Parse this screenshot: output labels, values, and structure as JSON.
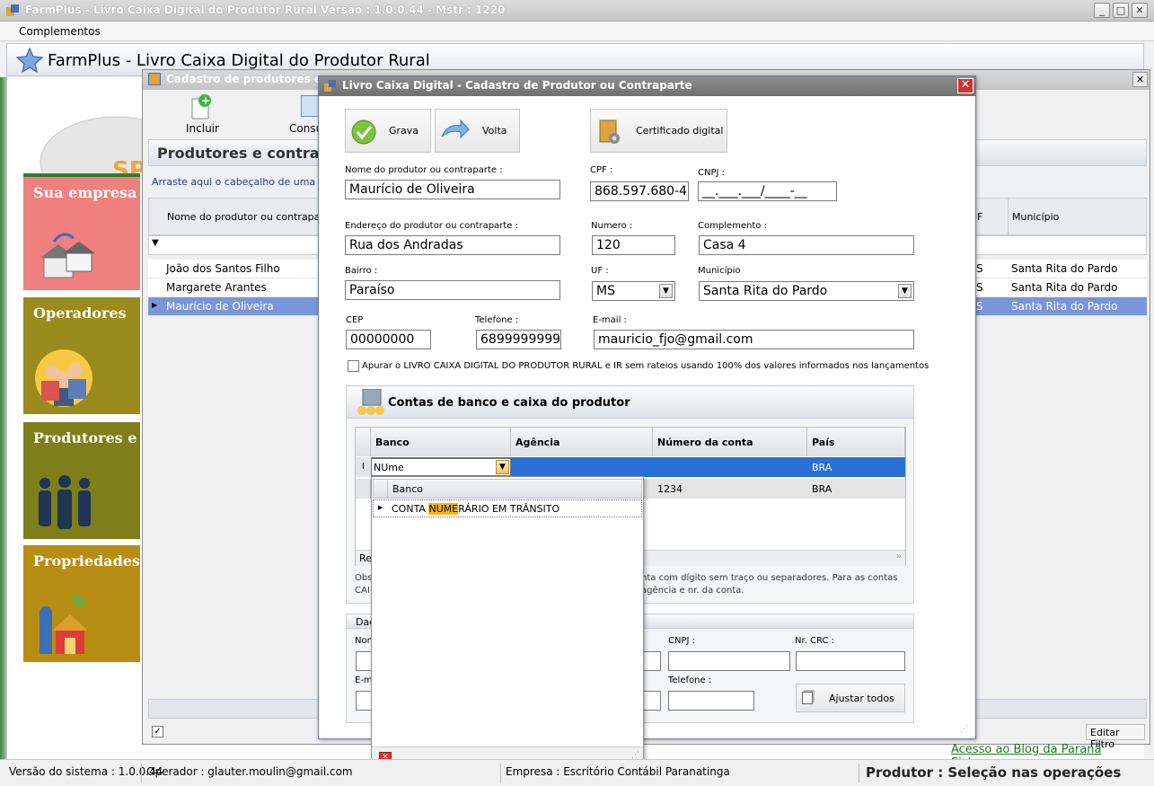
{
  "app": {
    "window_title": "FarmPlus - Livro Caixa Digital do Produtor Rural Versão : 1.0.0.44 - Mstr : 1220",
    "menu": [
      "Complementos"
    ],
    "header_title": "FarmPlus - Livro Caixa Digital do Produtor Rural"
  },
  "sidebar": {
    "items": [
      {
        "label": "Sua empresa",
        "color": "#f08080"
      },
      {
        "label": "Operadores",
        "color": "#9b8a1c"
      },
      {
        "label": "Produtores e c",
        "color": "#7e7e1a"
      },
      {
        "label": "Propriedades",
        "color": "#b88d14"
      }
    ]
  },
  "back_window": {
    "title": "Cadastro de produtores e c",
    "toolbar": {
      "incluir": "Incluir",
      "consultar": "Consu"
    },
    "section_title": "Produtores e contrapa",
    "group_hint": "Arraste aqui o cabeçalho de uma colun",
    "columns": {
      "nome": "Nome do produtor ou contraparte",
      "uf": "F",
      "municipio": "Município"
    },
    "rows": [
      {
        "nome": "João dos Santos Filho",
        "uf": "S",
        "municipio": "Santa Rita do Pardo"
      },
      {
        "nome": "Margarete Arantes",
        "uf": "S",
        "municipio": "Santa Rita do Pardo"
      },
      {
        "nome": "Maurício de Oliveira",
        "uf": "S",
        "municipio": "Santa Rita do Pardo"
      }
    ],
    "edit_filter": "Editar Filtro"
  },
  "dialog": {
    "title": "Livro Caixa Digital - Cadastro de Produtor ou Contraparte",
    "buttons": {
      "grava": "Grava",
      "volta": "Volta",
      "certificado": "Certificado digital"
    },
    "labels": {
      "nome": "Nome do produtor ou contraparte :",
      "cpf": "CPF :",
      "cnpj": "CNPJ :",
      "endereco": "Endereço do produtor ou contraparte :",
      "numero": "Numero :",
      "complemento": "Complemento :",
      "bairro": "Bairro :",
      "uf": "UF :",
      "municipio": "Município",
      "cep": "CEP",
      "telefone": "Telefone :",
      "email": "E-mail :"
    },
    "values": {
      "nome": "Maurício de Oliveira",
      "cpf": "868.597.680-45",
      "cnpj": "__.___.___/____-__",
      "endereco": "Rua dos Andradas",
      "numero": "120",
      "complemento": "Casa 4",
      "bairro": "Paraíso",
      "uf": "MS",
      "municipio": "Santa Rita do Pardo",
      "cep": "00000000",
      "telefone": "68999999999",
      "email": "mauricio_fjo@gmail.com"
    },
    "checkbox_label": "Apurar o LIVRO CAIXA DIGITAL DO PRODUTOR RURAL e IR sem rateios  usando 100% dos valores informados nos lançamentos",
    "contas": {
      "title": "Contas de banco e caixa do produtor",
      "columns": {
        "banco": "Banco",
        "agencia": "Agência",
        "numero": "Número da conta",
        "pais": "País"
      },
      "edit_row": {
        "indicator": "I",
        "banco": "NUme",
        "pais": "BRA"
      },
      "row2": {
        "numero": "1234",
        "pais": "BRA"
      },
      "footer_left": "Re",
      "obs_left1": "Obs",
      "obs_left2": "CAI",
      "obs_right1": "nta com dígito sem traço ou separadores. Para as contas",
      "obs_right2": "agência e nr. da conta."
    },
    "dados": {
      "title": "Dad",
      "nome_label": "Nom",
      "email_label": "E-m",
      "cnpj_label": "CNPJ :",
      "crc_label": "Nr. CRC :",
      "telefone_label": "Telefone :",
      "ajustar": "Ajustar todos"
    }
  },
  "dropdown": {
    "header": "Banco",
    "item_before": "CONTA ",
    "item_highlight": "NUME",
    "item_after": "RÁRIO EM TRÂNSITO"
  },
  "status": {
    "versao": "Versão do sistema : 1.0.0.44",
    "operador": "Operador : glauter.moulin@gmail.com",
    "empresa": "Empresa : Escritório Contábil Paranatinga",
    "produtor": "Produtor : Seleção nas operações",
    "blog_link": "Acesso ao Blog da Paraná Sistemas"
  }
}
